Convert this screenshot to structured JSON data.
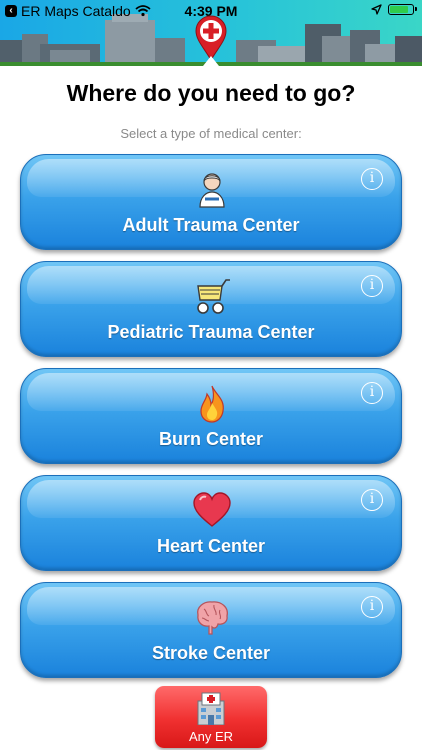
{
  "status_bar": {
    "back_app": "ER Maps Cataldo",
    "time": "4:39 PM",
    "battery_level": 0.85
  },
  "page": {
    "title": "Where do you need to go?",
    "subtitle": "Select a type of medical center:"
  },
  "centers": [
    {
      "label": "Adult Trauma Center",
      "icon": "adult-patient-icon",
      "info": "i"
    },
    {
      "label": "Pediatric Trauma Center",
      "icon": "baby-stroller-icon",
      "info": "i"
    },
    {
      "label": "Burn Center",
      "icon": "flame-icon",
      "info": "i"
    },
    {
      "label": "Heart Center",
      "icon": "heart-icon",
      "info": "i"
    },
    {
      "label": "Stroke Center",
      "icon": "brain-icon",
      "info": "i"
    }
  ],
  "any_er": {
    "label": "Any ER",
    "icon": "hospital-building-icon"
  },
  "colors": {
    "button_blue": "#3aa2ea",
    "any_er_red": "#f03030",
    "header_sky": "#27c3d9",
    "accent_green": "#3a8d2f"
  }
}
